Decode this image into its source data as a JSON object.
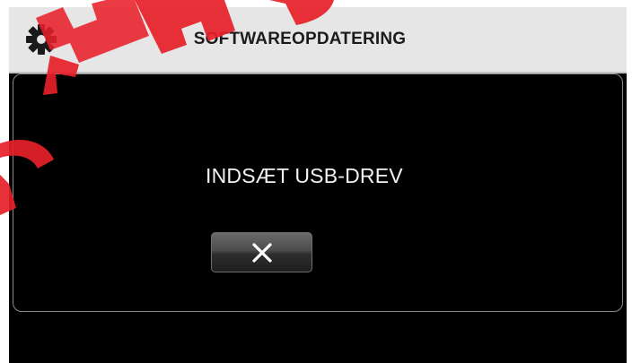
{
  "header": {
    "title": "SOFTWAREOPDATERING",
    "icon": "gear-icon"
  },
  "dialog": {
    "message": "INDSÆT USB-DREV",
    "cancel_button_icon": "close-icon"
  },
  "colors": {
    "header_bg": "#e6e6e6",
    "screen_bg": "#000000",
    "watermark": "#e8202a"
  }
}
